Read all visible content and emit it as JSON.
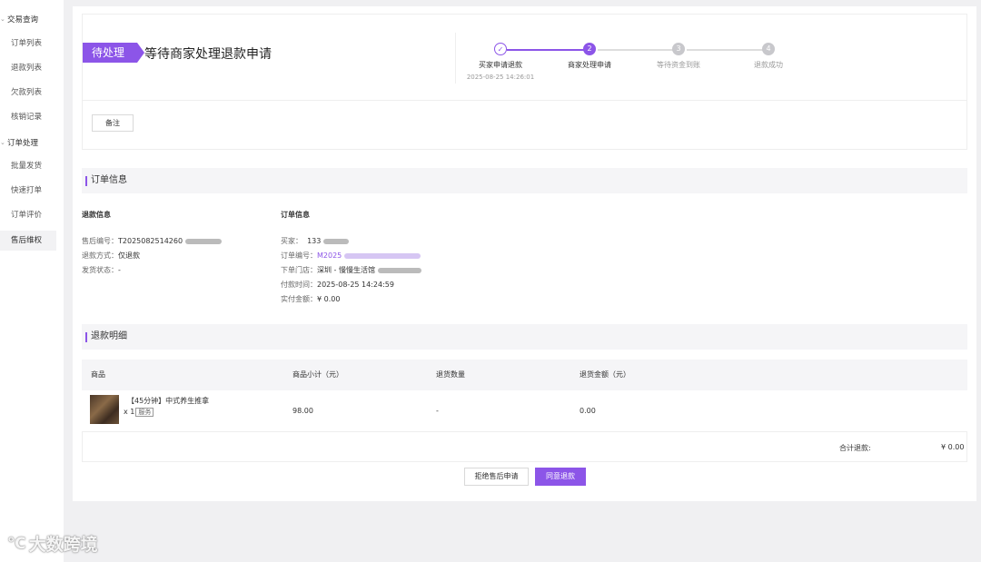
{
  "sidebar": {
    "groups": [
      {
        "label": "交易查询",
        "items": [
          "订单列表",
          "退款列表",
          "欠款列表",
          "核销记录"
        ]
      },
      {
        "label": "订单处理",
        "items": [
          "批量发货",
          "快速打单",
          "订单评价",
          "售后维权"
        ]
      }
    ],
    "active_item": "售后维权"
  },
  "status": {
    "tag": "待处理",
    "title": "等待商家处理退款申请"
  },
  "steps": [
    {
      "num": "✓",
      "label": "买家申请退款",
      "time": "2025-08-25 14:26:01",
      "state": "done"
    },
    {
      "num": "2",
      "label": "商家处理申请",
      "time": "",
      "state": "current"
    },
    {
      "num": "3",
      "label": "等待资金到账",
      "time": "",
      "state": "todo"
    },
    {
      "num": "4",
      "label": "退款成功",
      "time": "",
      "state": "todo"
    }
  ],
  "note_button": "备注",
  "order_section": {
    "title": "订单信息",
    "refund_info": {
      "heading": "退款信息",
      "rows": [
        {
          "key": "售后编号：",
          "value": "T2025082514260"
        },
        {
          "key": "退款方式：",
          "value": "仅退款"
        },
        {
          "key": "发货状态：",
          "value": "-"
        }
      ]
    },
    "order_info": {
      "heading": "订单信息",
      "rows": [
        {
          "key": "买家：",
          "value": "133"
        },
        {
          "key": "订单编号：",
          "value": "M2025"
        },
        {
          "key": "下单门店：",
          "value": "深圳 - 慢慢生活馆"
        },
        {
          "key": "付款时间：",
          "value": "2025-08-25 14:24:59"
        },
        {
          "key": "实付金额：",
          "value": "¥ 0.00"
        }
      ]
    }
  },
  "refund_section": {
    "title": "退款明细",
    "columns": [
      "商品",
      "商品小计（元）",
      "退货数量",
      "退货金额（元）"
    ],
    "rows": [
      {
        "name": "【45分钟】中式养生推拿",
        "qty": "x 1",
        "tag": "服务",
        "subtotal": "98.00",
        "return_qty": "-",
        "return_amount": "0.00"
      }
    ],
    "total_label": "合计退款:",
    "total_value": "¥ 0.00"
  },
  "actions": {
    "reject": "拒绝售后申请",
    "agree": "同意退款"
  },
  "watermark": "大数跨境",
  "colors": {
    "accent": "#8c55e8",
    "step_todo": "#c8c8cc"
  }
}
